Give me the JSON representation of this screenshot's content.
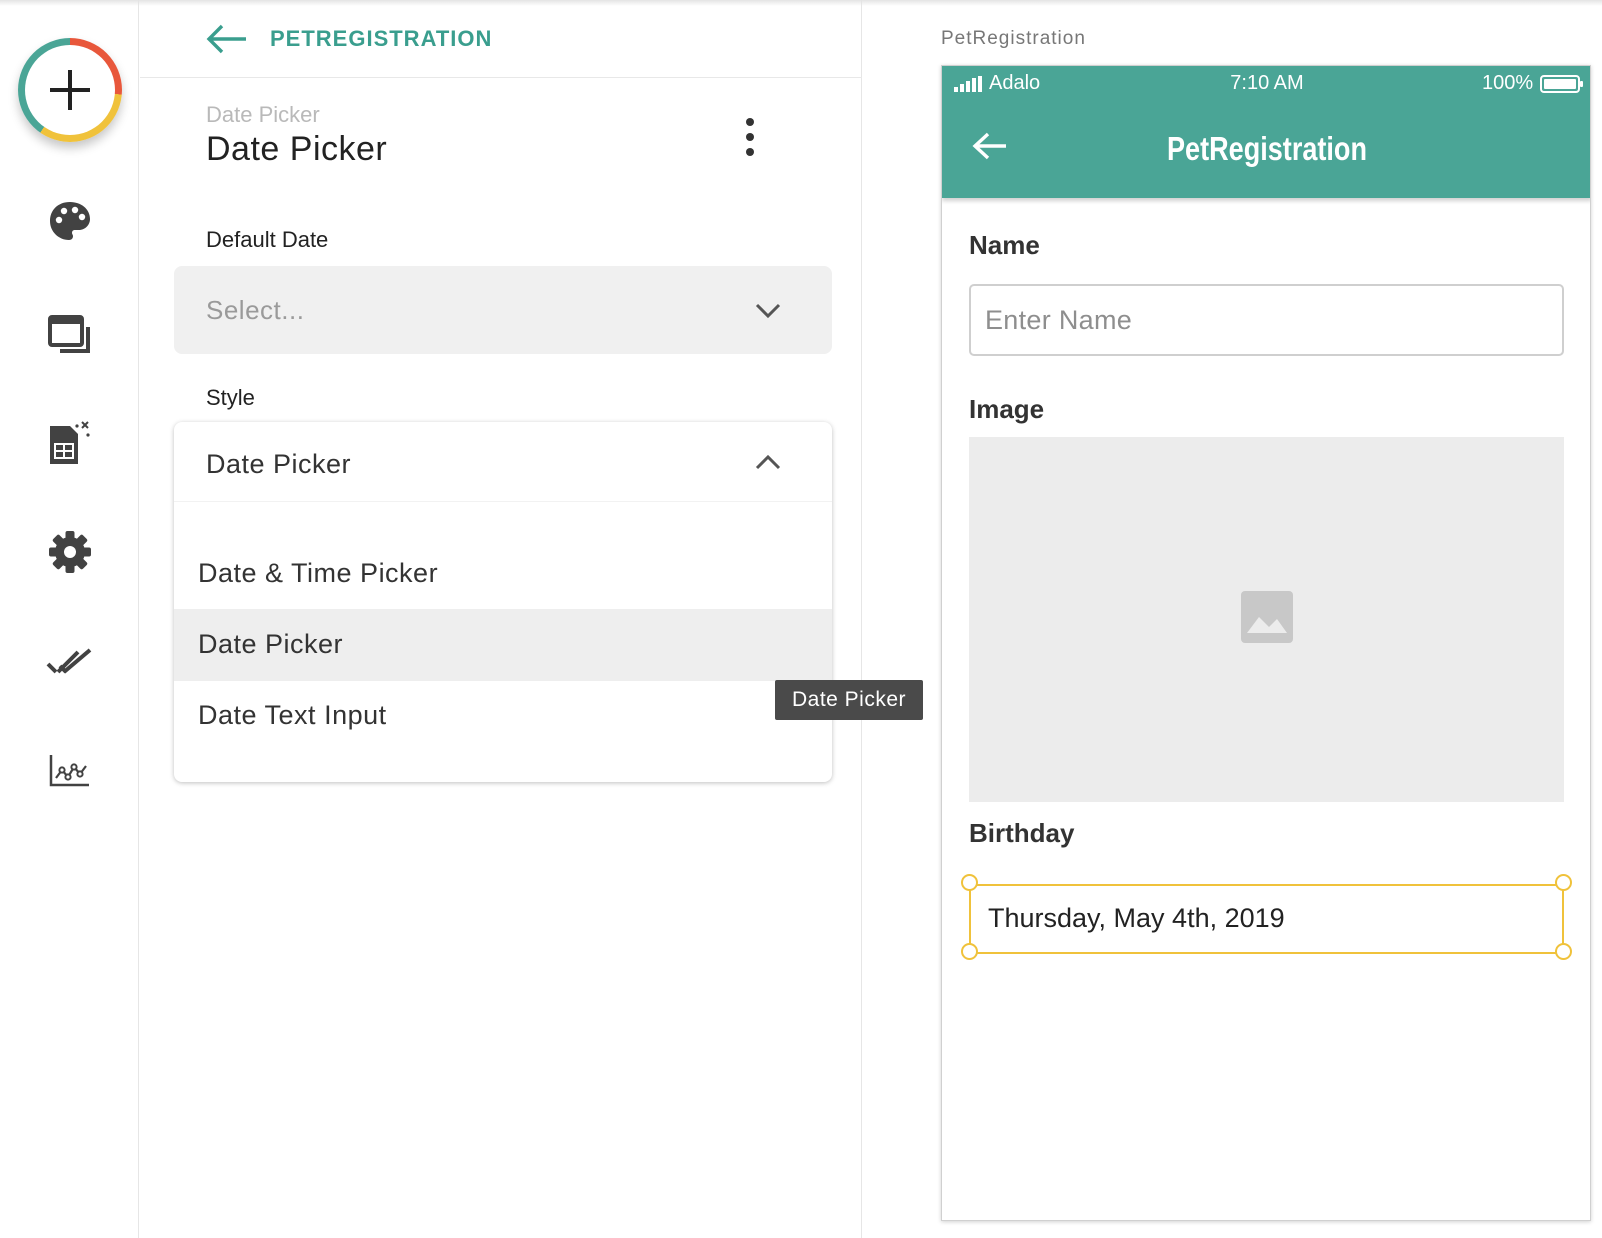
{
  "header": {
    "back_label": "PETREGISTRATION"
  },
  "component": {
    "type_label": "Date Picker",
    "name": "Date Picker"
  },
  "properties": {
    "default_date": {
      "label": "Default Date",
      "placeholder": "Select..."
    },
    "style": {
      "label": "Style",
      "selected": "Date Picker",
      "options": [
        {
          "label": "Date & Time Picker",
          "selected": false
        },
        {
          "label": "Date Picker",
          "selected": true
        },
        {
          "label": "Date Text Input",
          "selected": false
        }
      ]
    }
  },
  "tooltip": {
    "text": "Date Picker"
  },
  "preview": {
    "screen_name": "PetRegistration",
    "status_bar": {
      "carrier": "Adalo",
      "time": "7:10 AM",
      "battery": "100%"
    },
    "app_bar": {
      "title": "PetRegistration"
    },
    "fields": {
      "name": {
        "label": "Name",
        "placeholder": "Enter Name"
      },
      "image": {
        "label": "Image"
      },
      "birthday": {
        "label": "Birthday",
        "value": "Thursday, May 4th, 2019"
      }
    }
  },
  "rail": {
    "icons": [
      "add-icon",
      "palette-icon",
      "screens-icon",
      "database-icon",
      "settings-icon",
      "publish-check-icon",
      "analytics-icon"
    ]
  },
  "colors": {
    "accent": "#4aa596",
    "accent_text": "#3a9e8e",
    "selection": "#f0c23b",
    "ring_red": "#e8573b"
  }
}
